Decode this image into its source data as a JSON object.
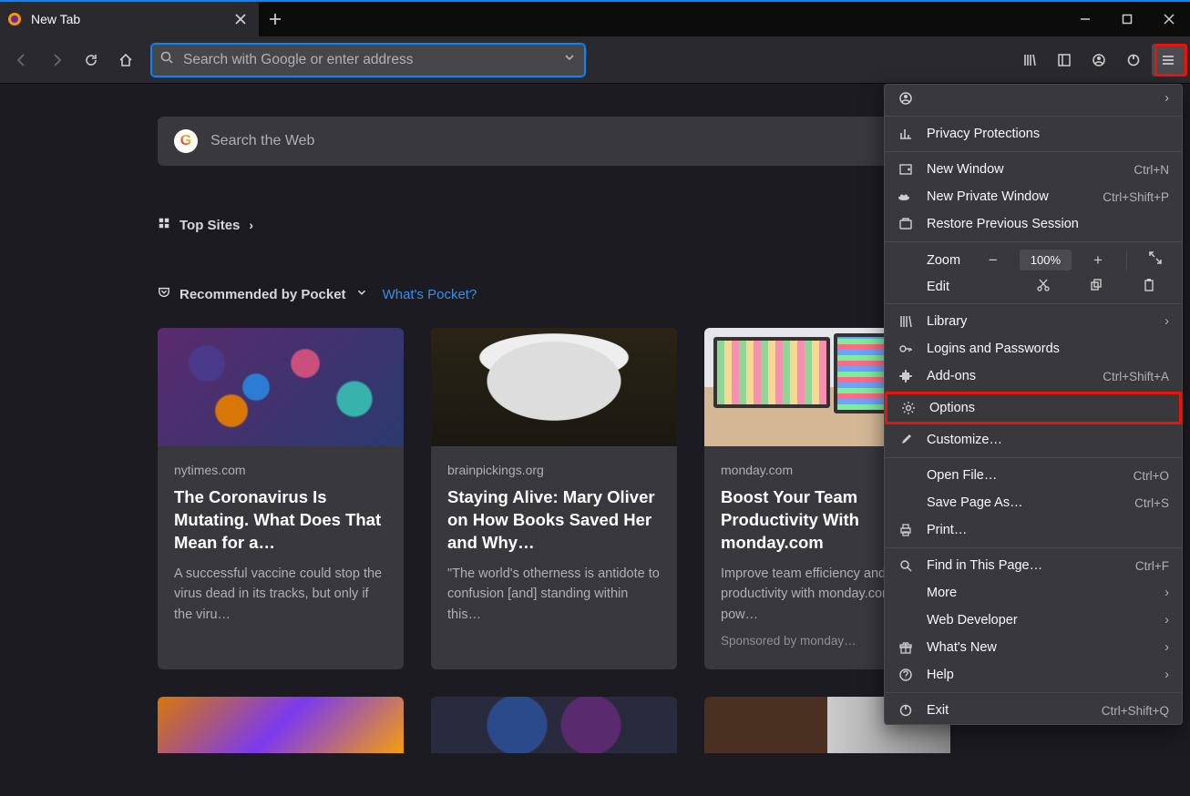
{
  "tab": {
    "title": "New Tab"
  },
  "urlbar": {
    "placeholder": "Search with Google or enter address"
  },
  "websearch": {
    "placeholder": "Search the Web"
  },
  "sections": {
    "topsites": "Top Sites",
    "pocket": "Recommended by Pocket",
    "pocket_link": "What's Pocket?"
  },
  "cards": [
    {
      "source": "nytimes.com",
      "title": "The Coronavirus Is Mutating. What Does That Mean for a…",
      "desc": "A successful vaccine could stop the virus dead in its tracks, but only if the viru…"
    },
    {
      "source": "brainpickings.org",
      "title": "Staying Alive: Mary Oliver on How Books Saved Her and Why…",
      "desc": "\"The world's otherness is antidote to confusion [and] standing within this…"
    },
    {
      "source": "monday.com",
      "title": "Boost Your Team Productivity With monday.com",
      "desc": "Improve team efficiency and productivity with monday.com, a pow…",
      "sponsor": "Sponsored by monday…"
    }
  ],
  "menu": {
    "account_sub": "›",
    "privacy": "Privacy Protections",
    "new_window": "New Window",
    "new_window_sc": "Ctrl+N",
    "new_private": "New Private Window",
    "new_private_sc": "Ctrl+Shift+P",
    "restore": "Restore Previous Session",
    "zoom": "Zoom",
    "zoom_pct": "100%",
    "edit": "Edit",
    "library": "Library",
    "logins": "Logins and Passwords",
    "addons": "Add-ons",
    "addons_sc": "Ctrl+Shift+A",
    "options": "Options",
    "customize": "Customize…",
    "open_file": "Open File…",
    "open_file_sc": "Ctrl+O",
    "save_as": "Save Page As…",
    "save_as_sc": "Ctrl+S",
    "print": "Print…",
    "find": "Find in This Page…",
    "find_sc": "Ctrl+F",
    "more": "More",
    "webdev": "Web Developer",
    "whatsnew": "What's New",
    "help": "Help",
    "exit": "Exit",
    "exit_sc": "Ctrl+Shift+Q"
  }
}
